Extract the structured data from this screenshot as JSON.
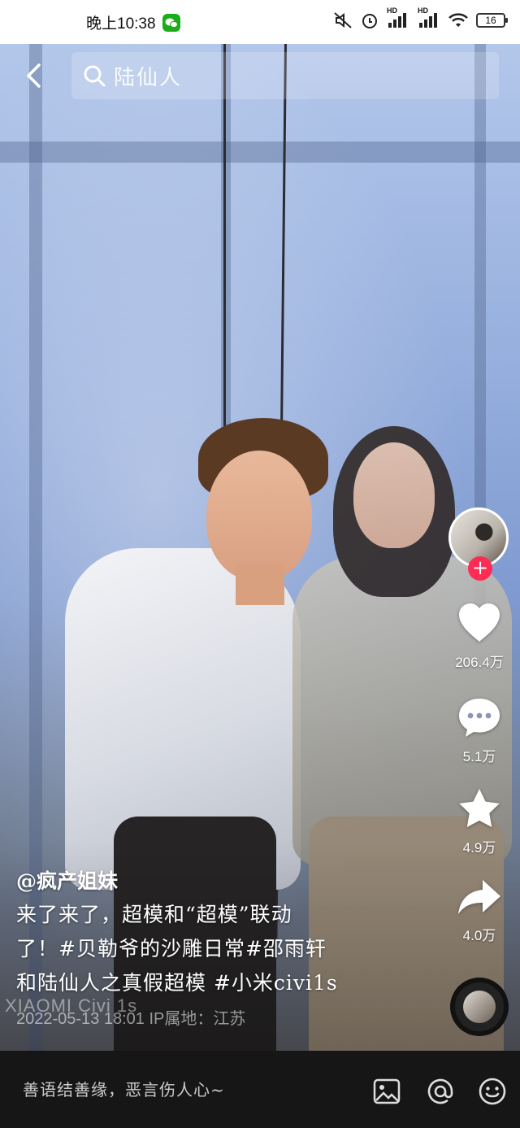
{
  "status_bar": {
    "time": "晚上10:38",
    "network_1": "HD",
    "network_2": "HD",
    "battery": "16"
  },
  "search": {
    "query": "陆仙人"
  },
  "video": {
    "watermark": "XIAOMI Civi 1s"
  },
  "actions": {
    "likes": "206.4万",
    "comments": "5.1万",
    "favorites": "4.9万",
    "shares": "4.0万"
  },
  "caption": {
    "author": "@疯产姐妹",
    "description_line1": "来了来了，超模和“超模”联动",
    "description_line2": "了！#贝勒爷的沙雕日常#邵雨轩",
    "description_line3": "和陆仙人之真假超模 #小米civi1s",
    "meta": "2022-05-13 18:01  IP属地：江苏"
  },
  "comment_bar": {
    "placeholder": "善语结善缘，恶言伤人心~"
  },
  "colors": {
    "accent": "#fe2c55",
    "wechat": "#1aad19"
  }
}
